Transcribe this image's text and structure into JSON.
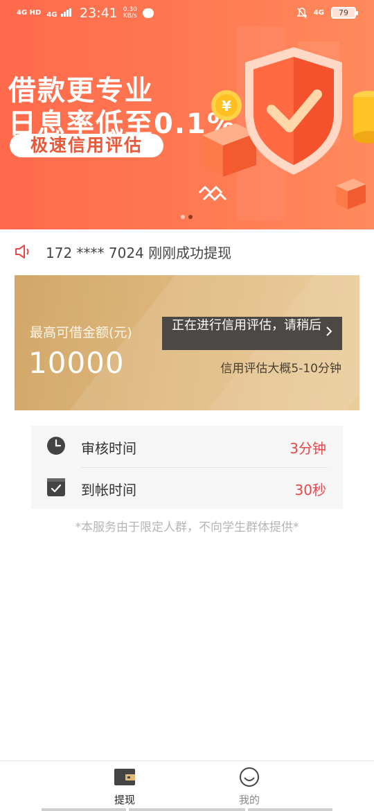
{
  "status_bar": {
    "signal1": "4G HD",
    "signal2": "4G",
    "time": "23:41",
    "speed_value": "0.30",
    "speed_unit": "KB/s",
    "signal3": "4G",
    "battery": "79",
    "icons": [
      "chat-icon",
      "mute-bell-icon",
      "battery-icon"
    ]
  },
  "banner": {
    "line1": "借款更专业",
    "line2": "日息率低至0.1%",
    "pill": "极速信用评估",
    "coin_symbol": "¥",
    "slide_count": 2,
    "active_slide": 1
  },
  "notice": {
    "icon": "speaker-icon",
    "text": "172  ****  7024 刚刚成功提现"
  },
  "loan_card": {
    "label": "最高可借金额(元)",
    "amount": "10000",
    "eval_button": "正在进行信用评估，请稍后",
    "eval_note": "信用评估大概5-10分钟"
  },
  "info": {
    "rows": [
      {
        "icon": "clock-icon",
        "label": "审核时间",
        "value": "3分钟"
      },
      {
        "icon": "checkbox-icon",
        "label": "到帐时间",
        "value": "30秒"
      }
    ]
  },
  "disclaimer": "*本服务由于限定人群，不向学生群体提供*",
  "bottom_nav": {
    "items": [
      {
        "icon": "wallet-icon",
        "label": "提现",
        "active": true
      },
      {
        "icon": "smiley-icon",
        "label": "我的",
        "active": false
      }
    ]
  },
  "colors": {
    "banner": "#ff6f4f",
    "accent_red": "#e8474a",
    "card_gold": "#deb77d",
    "dark_button": "#4b4845"
  }
}
